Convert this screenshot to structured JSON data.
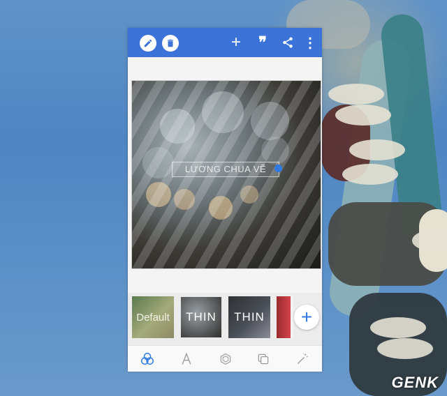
{
  "app": {
    "toolbar": {
      "edit_icon": "pencil-icon",
      "delete_icon": "trash-icon",
      "add_label": "+",
      "quote_label": "❞",
      "share_icon": "share-icon",
      "more_label": "⋮"
    },
    "canvas": {
      "text_overlay": "LƯƠNG CHUA VẼ"
    },
    "filters": {
      "items": [
        {
          "label": "Default"
        },
        {
          "label": "THIN"
        },
        {
          "label": "THIN"
        },
        {
          "label": ""
        }
      ],
      "add_label": "+"
    },
    "bottom_bar": {
      "items": [
        {
          "icon": "color-filter-icon",
          "active": true
        },
        {
          "icon": "text-font-icon"
        },
        {
          "icon": "hexagon-shape-icon"
        },
        {
          "icon": "layers-icon"
        },
        {
          "icon": "magic-wand-icon"
        }
      ]
    }
  },
  "watermark": "GENK",
  "colors": {
    "toolbar": "#3b73d8",
    "accent": "#2f7be3",
    "panel": "#f4f4f4"
  }
}
